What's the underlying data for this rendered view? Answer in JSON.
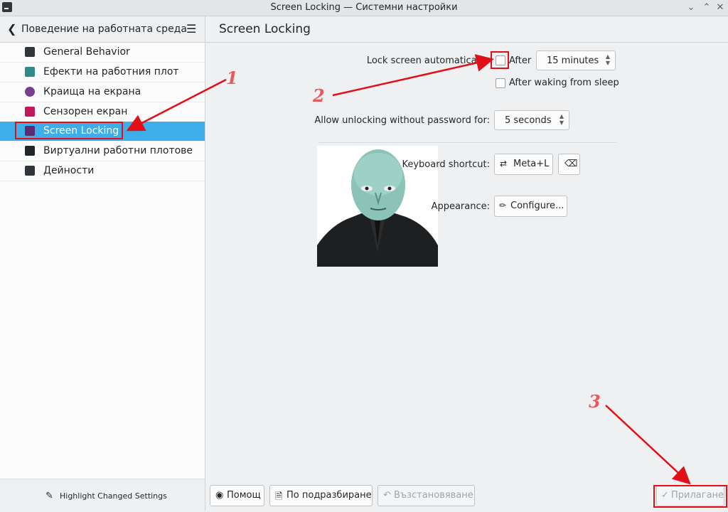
{
  "window": {
    "title": "Screen Locking — Системни настройки",
    "controls": [
      "⌄",
      "⌃",
      "✕"
    ]
  },
  "sidebar": {
    "header_title": "Поведение на работната среда",
    "items": [
      {
        "label": "General Behavior",
        "icon": "general-behavior-icon",
        "color": "#31363b"
      },
      {
        "label": "Ефекти на работния плот",
        "icon": "desktop-effects-icon",
        "color": "#2e8b8b"
      },
      {
        "label": "Краища на екрана",
        "icon": "screen-edges-icon",
        "color": "#7a3e8e"
      },
      {
        "label": "Сензорен екран",
        "icon": "touch-screen-icon",
        "color": "#c2185b"
      },
      {
        "label": "Screen Locking",
        "icon": "screen-locking-icon",
        "color": "#5a2b6e",
        "selected": true
      },
      {
        "label": "Виртуални работни плотове",
        "icon": "virtual-desktops-icon",
        "color": "#232629"
      },
      {
        "label": "Дейности",
        "icon": "activities-icon",
        "color": "#31363b"
      }
    ],
    "footer_label": "Highlight Changed Settings"
  },
  "main": {
    "page_title": "Screen Locking",
    "lock_auto_label": "Lock screen automatically:",
    "after_label": "After",
    "after_value": "15 minutes",
    "after_waking_label": "After waking from sleep",
    "unlock_label": "Allow unlocking without password for:",
    "unlock_value": "5 seconds",
    "shortcut_label": "Keyboard shortcut:",
    "shortcut_value": "Meta+L",
    "appearance_label": "Appearance:",
    "configure_label": "Configure..."
  },
  "footer": {
    "help": "Помощ",
    "defaults": "По подразбиране",
    "reset": "Възстановяване",
    "apply": "Прилагане"
  },
  "annotations": [
    "1",
    "2",
    "3"
  ],
  "colors": {
    "accent": "#3daee9",
    "annotation_red": "#e20f17"
  }
}
